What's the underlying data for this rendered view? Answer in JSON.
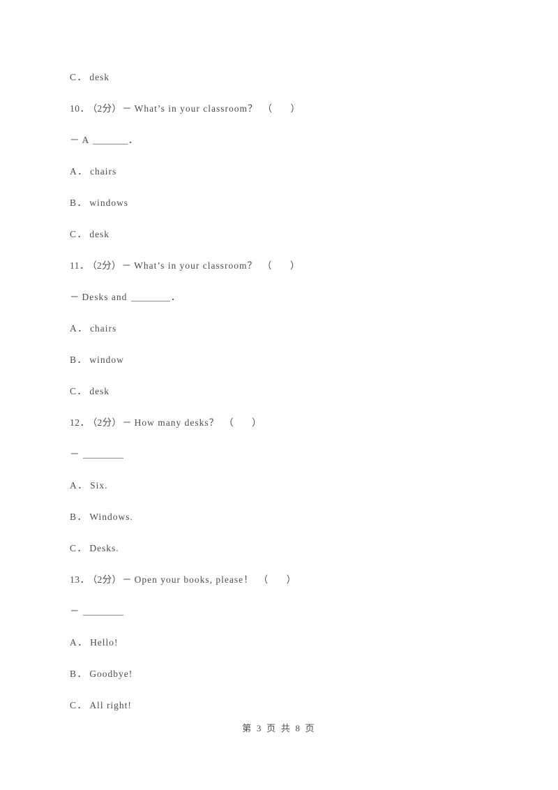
{
  "document": {
    "page_label": "第 3 页 共 8 页",
    "blocks": [
      {
        "kind": "option",
        "label": "C．",
        "text": "desk"
      },
      {
        "kind": "question",
        "number": "10．",
        "marks": "（2分）",
        "dash": "－",
        "stem": "What’s in your classroom？",
        "paren_open": "（",
        "paren_close": "）"
      },
      {
        "kind": "dialog",
        "dash": "－",
        "before": "A",
        "blank": "short",
        "after": "．"
      },
      {
        "kind": "option",
        "label": "A．",
        "text": "chairs"
      },
      {
        "kind": "option",
        "label": "B．",
        "text": "windows"
      },
      {
        "kind": "option",
        "label": "C．",
        "text": "desk"
      },
      {
        "kind": "question",
        "number": "11．",
        "marks": "（2分）",
        "dash": "－",
        "stem": "What’s in your classroom？",
        "paren_open": "（",
        "paren_close": "）"
      },
      {
        "kind": "dialog",
        "dash": "－",
        "before": "Desks and",
        "blank": "mid",
        "after": "．"
      },
      {
        "kind": "option",
        "label": "A．",
        "text": "chairs"
      },
      {
        "kind": "option",
        "label": "B．",
        "text": "window"
      },
      {
        "kind": "option",
        "label": "C．",
        "text": "desk"
      },
      {
        "kind": "question",
        "number": "12．",
        "marks": "（2分）",
        "dash": "－",
        "stem": "How many desks？",
        "paren_open": "（",
        "paren_close": "）"
      },
      {
        "kind": "dialog",
        "dash": "－",
        "before": "",
        "blank": "long",
        "after": ""
      },
      {
        "kind": "option",
        "label": "A．",
        "text": "Six."
      },
      {
        "kind": "option",
        "label": "B．",
        "text": "Windows."
      },
      {
        "kind": "option",
        "label": "C．",
        "text": "Desks."
      },
      {
        "kind": "question",
        "number": "13．",
        "marks": "（2分）",
        "dash": "－",
        "stem": "Open your books, please！",
        "paren_open": "（",
        "paren_close": "）"
      },
      {
        "kind": "dialog",
        "dash": "－",
        "before": "",
        "blank": "long",
        "after": ""
      },
      {
        "kind": "option",
        "label": "A．",
        "text": "Hello!"
      },
      {
        "kind": "option",
        "label": "B．",
        "text": "Goodbye!"
      },
      {
        "kind": "option",
        "label": "C．",
        "text": "All right!"
      }
    ]
  },
  "colors": {
    "page_background": "#ffffff",
    "text": "#4d4d4d",
    "blank_rule": "#8a8a8a"
  }
}
